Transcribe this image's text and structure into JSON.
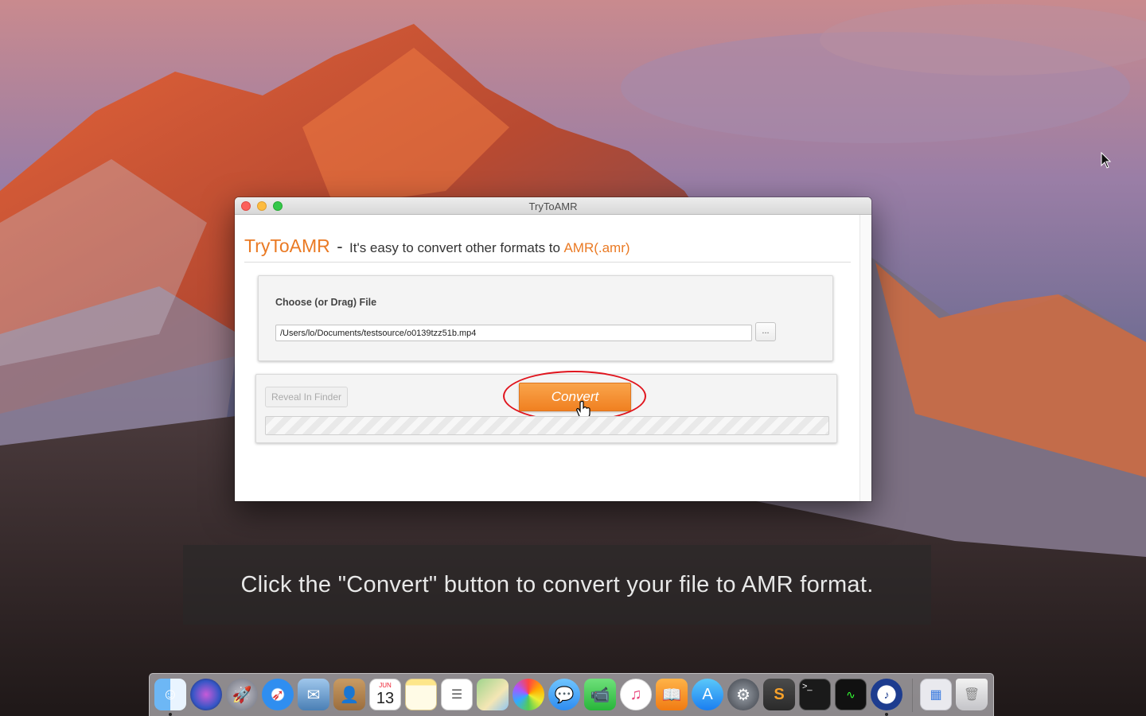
{
  "window": {
    "title": "TryToAMR"
  },
  "header": {
    "brand": "TryToAMR",
    "dash": "-",
    "tagline": "It's easy to convert other formats to",
    "format": "AMR(.amr)"
  },
  "choose_panel": {
    "label": "Choose (or Drag) File",
    "file_path": "/Users/lo/Documents/testsource/o0139tzz51b.mp4",
    "browse_label": "..."
  },
  "action_panel": {
    "reveal_label": "Reveal In Finder",
    "convert_label": "Convert",
    "progress": 0
  },
  "caption": {
    "text": "Click the \"Convert\" button to convert your file to AMR format."
  },
  "dock": {
    "calendar_month": "JUN",
    "calendar_day": "13",
    "items": [
      "finder-icon",
      "siri-icon",
      "launchpad-icon",
      "safari-icon",
      "mail-icon",
      "contacts-icon",
      "calendar-icon",
      "notes-icon",
      "reminders-icon",
      "maps-icon",
      "photos-icon",
      "messages-icon",
      "facetime-icon",
      "itunes-icon",
      "ibooks-icon",
      "app-store-icon",
      "system-preferences-icon",
      "sublime-text-icon",
      "terminal-icon",
      "activity-monitor-icon",
      "trytoamr-icon",
      "downloads-stack-icon",
      "trash-icon"
    ]
  },
  "colors": {
    "brand_orange": "#ea7a24",
    "convert_button": "#f08021",
    "highlight_ring": "#e0141d"
  }
}
